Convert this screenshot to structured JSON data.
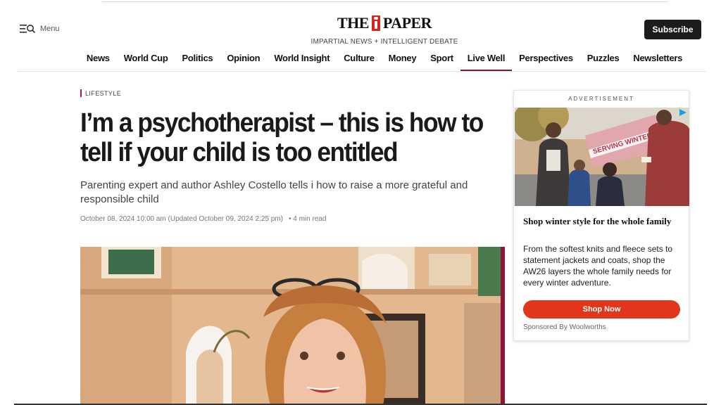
{
  "header": {
    "menu_label": "Menu",
    "logo_left": "THE",
    "logo_right": "PAPER",
    "tagline": "IMPARTIAL NEWS + INTELLIGENT DEBATE",
    "subscribe_label": "Subscribe",
    "brand_color": "#d8241e"
  },
  "nav": {
    "items": [
      "News",
      "World Cup",
      "Politics",
      "Opinion",
      "World Insight",
      "Culture",
      "Money",
      "Sport",
      "Live Well",
      "Perspectives",
      "Puzzles",
      "Newsletters"
    ],
    "active": "Live Well",
    "active_color": "#8a1538"
  },
  "article": {
    "section": "LIFESTYLE",
    "headline": "I’m a psychotherapist – this is how to tell if your child is too entitled",
    "standfirst": "Parenting expert and author Ashley Costello tells i how to raise a more grateful and responsible child",
    "published": "October 08, 2024 10:00 am (Updated October 09, 2024 2:25 pm)",
    "read_time": "• 4 min read"
  },
  "ad": {
    "label": "ADVERTISEMENT",
    "title": "Shop winter style for the whole family",
    "body": "From the softest knits and fleece sets to statement jackets and coats, shop the AW26 layers the whole family needs for every winter adventure.",
    "cta": "Shop Now",
    "sponsor": "Sponsored By Woolworths",
    "image_text": "SERVING WINTER",
    "cta_color": "#e2361c"
  }
}
